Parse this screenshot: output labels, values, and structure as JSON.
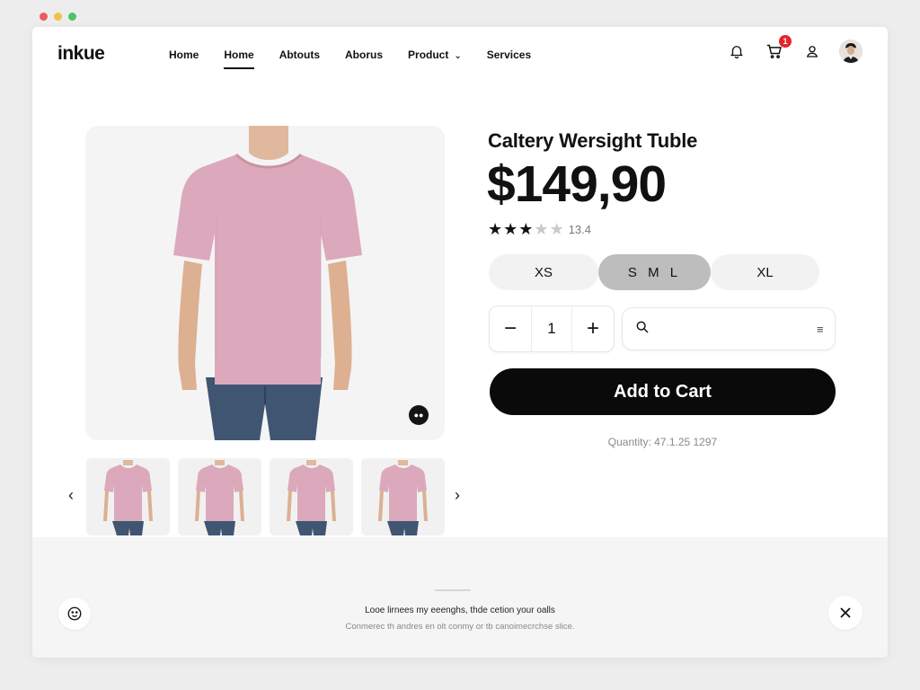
{
  "brand": {
    "logo": "inkue"
  },
  "nav": {
    "items": [
      {
        "label": "Home"
      },
      {
        "label": "Home"
      },
      {
        "label": "Abtouts"
      },
      {
        "label": "Aborus"
      },
      {
        "label": "Product"
      },
      {
        "label": "Services"
      }
    ],
    "active_index": 1
  },
  "header": {
    "cart_count": "1"
  },
  "product": {
    "title": "Caltery Wersight Tuble",
    "price": "$149,90",
    "rating_stars": 3,
    "rating_max": 5,
    "rating_value": "13.4",
    "sizes": [
      "XS",
      "S M L",
      "XL"
    ],
    "selected_size": "S M L",
    "quantity": "1",
    "add_to_cart": "Add to Cart",
    "stock_text": "Quantity: 47.1.25 1297",
    "shirt_color": "#dba9bb"
  },
  "footer": {
    "title": "Looe lirnees my eeenghs, thde cetion your oalls",
    "subtitle": "Conmerec th andres en olt conmy or tb canoimecrchse slice."
  }
}
